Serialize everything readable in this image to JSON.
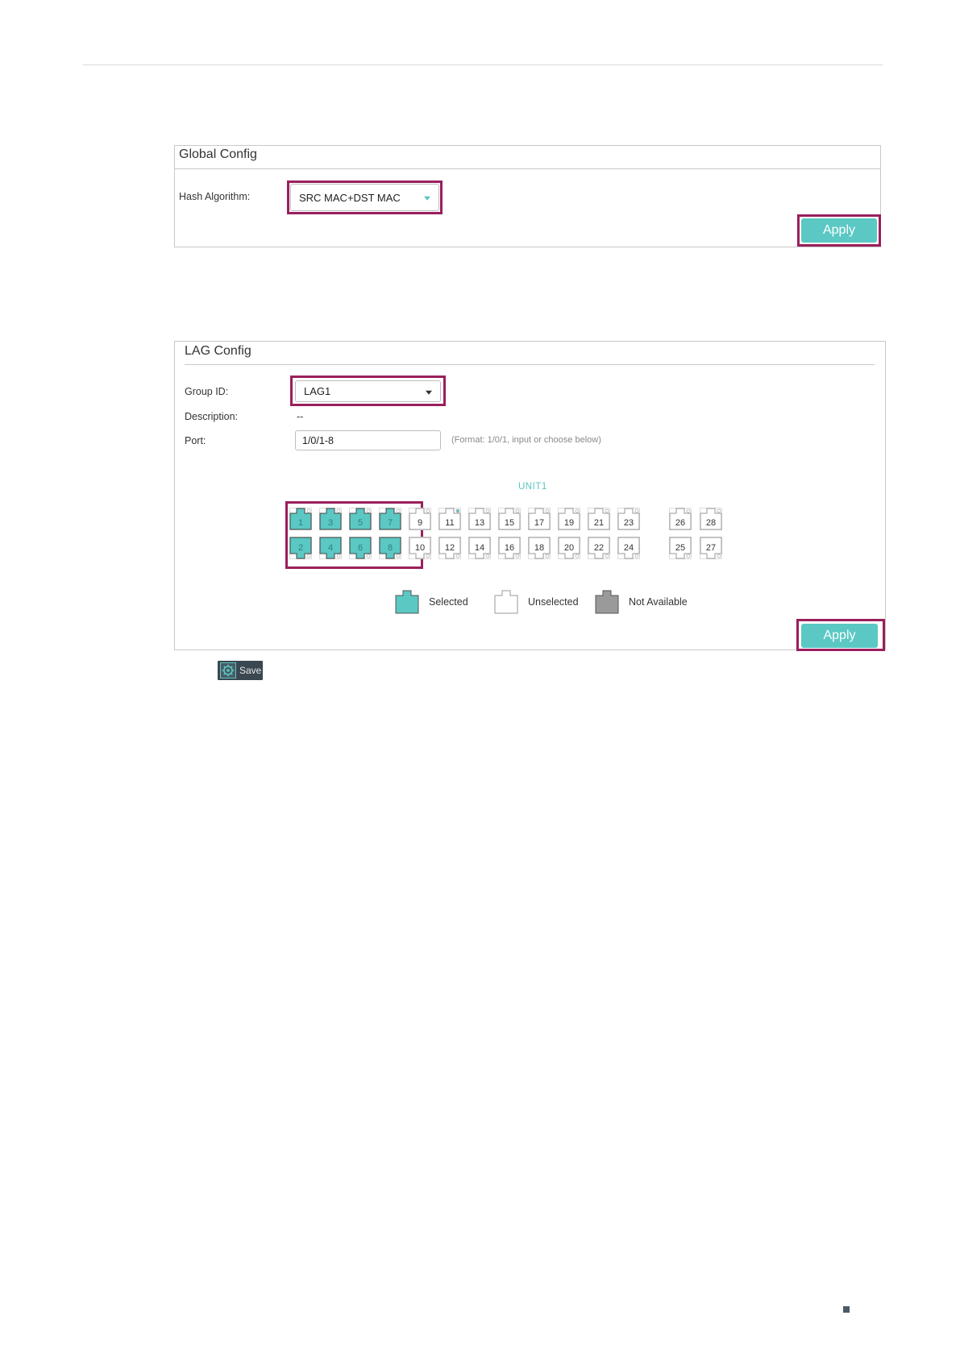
{
  "global_config": {
    "title": "Global Config",
    "hash_algorithm_label": "Hash Algorithm:",
    "hash_algorithm_value": "SRC MAC+DST MAC",
    "apply_label": "Apply"
  },
  "lag_config": {
    "title": "LAG Config",
    "group_id_label": "Group ID:",
    "group_id_value": "LAG1",
    "description_label": "Description:",
    "description_value": "--",
    "port_label": "Port:",
    "port_value": "1/0/1-8",
    "port_hint": "(Format: 1/0/1, input or choose below)",
    "unit_label": "UNIT1",
    "ports_top": [
      "1",
      "3",
      "5",
      "7",
      "9",
      "11",
      "13",
      "15",
      "17",
      "19",
      "21",
      "23",
      "26",
      "28"
    ],
    "ports_bottom": [
      "2",
      "4",
      "6",
      "8",
      "10",
      "12",
      "14",
      "16",
      "18",
      "20",
      "22",
      "24",
      "25",
      "27"
    ],
    "selected_ports": [
      "1",
      "2",
      "3",
      "4",
      "5",
      "6",
      "7",
      "8"
    ],
    "link_up_ports": [
      "11"
    ],
    "legend": {
      "selected": "Selected",
      "unselected": "Unselected",
      "not_available": "Not Available"
    },
    "apply_label": "Apply"
  },
  "save_label": "Save",
  "colors": {
    "accent": "#5bc8c4",
    "highlight": "#9a1f5c",
    "not_available": "#9a9a9a"
  }
}
